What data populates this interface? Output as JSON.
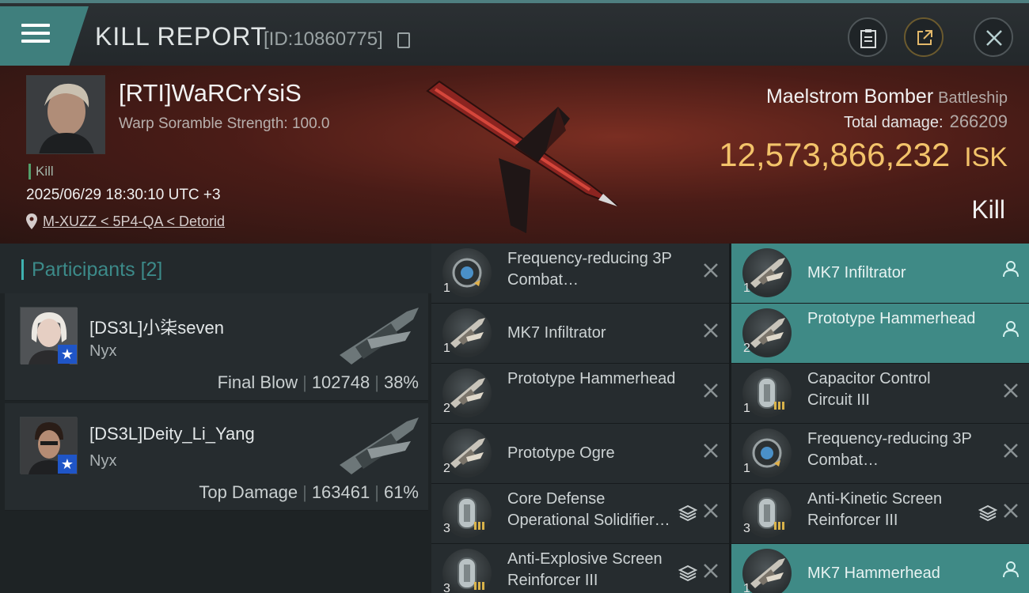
{
  "header": {
    "title": "KILL REPORT",
    "report_id": "[ID:10860775]",
    "icons": [
      "menu-icon",
      "copy-icon",
      "clipboard-icon",
      "share-icon",
      "close-icon"
    ]
  },
  "victim": {
    "name": "[RTI]WaRCrYsiS",
    "scramble": "Warp Soramble Strength: 100.0",
    "tag": "Kill",
    "time": "2025/06/29 18:30:10 UTC +3",
    "location": "M-XUZZ < 5P4-QA < Detorid",
    "ship_name": "Maelstrom Bomber",
    "ship_class": "Battleship",
    "total_damage_label": "Total damage:",
    "total_damage": "266209",
    "isk_value": "12,573,866,232",
    "isk_unit": "ISK",
    "result": "Kill"
  },
  "participants": {
    "title": "Participants",
    "count": "[2]",
    "rows": [
      {
        "name": "[DS3L]小柒seven",
        "ship": "Nyx",
        "role": "Final Blow",
        "damage": "102748",
        "percent": "38%"
      },
      {
        "name": "[DS3L]Deity_Li_Yang",
        "ship": "Nyx",
        "role": "Top Damage",
        "damage": "163461",
        "percent": "61%"
      }
    ]
  },
  "items_left": [
    {
      "qty": "1",
      "name": "Frequency-reducing 3P Combat…",
      "icon": "module-icon",
      "status": "destroyed"
    },
    {
      "qty": "1",
      "name": "MK7  Infiltrator",
      "icon": "drone-icon",
      "status": "destroyed"
    },
    {
      "qty": "2",
      "name": "Prototype Hammerhead",
      "icon": "drone-icon",
      "status": "destroyed"
    },
    {
      "qty": "2",
      "name": "Prototype  Ogre",
      "icon": "drone-icon",
      "status": "destroyed"
    },
    {
      "qty": "3",
      "name": "Core Defense Operational Solidifier…",
      "icon": "rig-icon",
      "status": "destroyed",
      "stacked": true
    },
    {
      "qty": "3",
      "name": "Anti-Explosive Screen Reinforcer III",
      "icon": "rig-icon",
      "status": "destroyed",
      "stacked": true
    }
  ],
  "items_right": [
    {
      "qty": "1",
      "name": "MK7  Infiltrator",
      "icon": "drone-icon",
      "status": "dropped"
    },
    {
      "qty": "2",
      "name": "Prototype Hammerhead",
      "icon": "drone-icon",
      "status": "dropped"
    },
    {
      "qty": "1",
      "name": "Capacitor Control Circuit III",
      "icon": "rig-icon",
      "status": "destroyed"
    },
    {
      "qty": "1",
      "name": "Frequency-reducing 3P Combat…",
      "icon": "module-icon",
      "status": "destroyed"
    },
    {
      "qty": "3",
      "name": "Anti-Kinetic Screen Reinforcer III",
      "icon": "rig-icon",
      "status": "destroyed",
      "stacked": true
    },
    {
      "qty": "1",
      "name": "MK7  Hammerhead",
      "icon": "drone-icon",
      "status": "dropped"
    }
  ],
  "colors": {
    "accent": "#3f7f7d",
    "isk": "#f3c36a",
    "dropped_bg": "#3f8a86",
    "destroyed_bg": "#262c2f"
  }
}
